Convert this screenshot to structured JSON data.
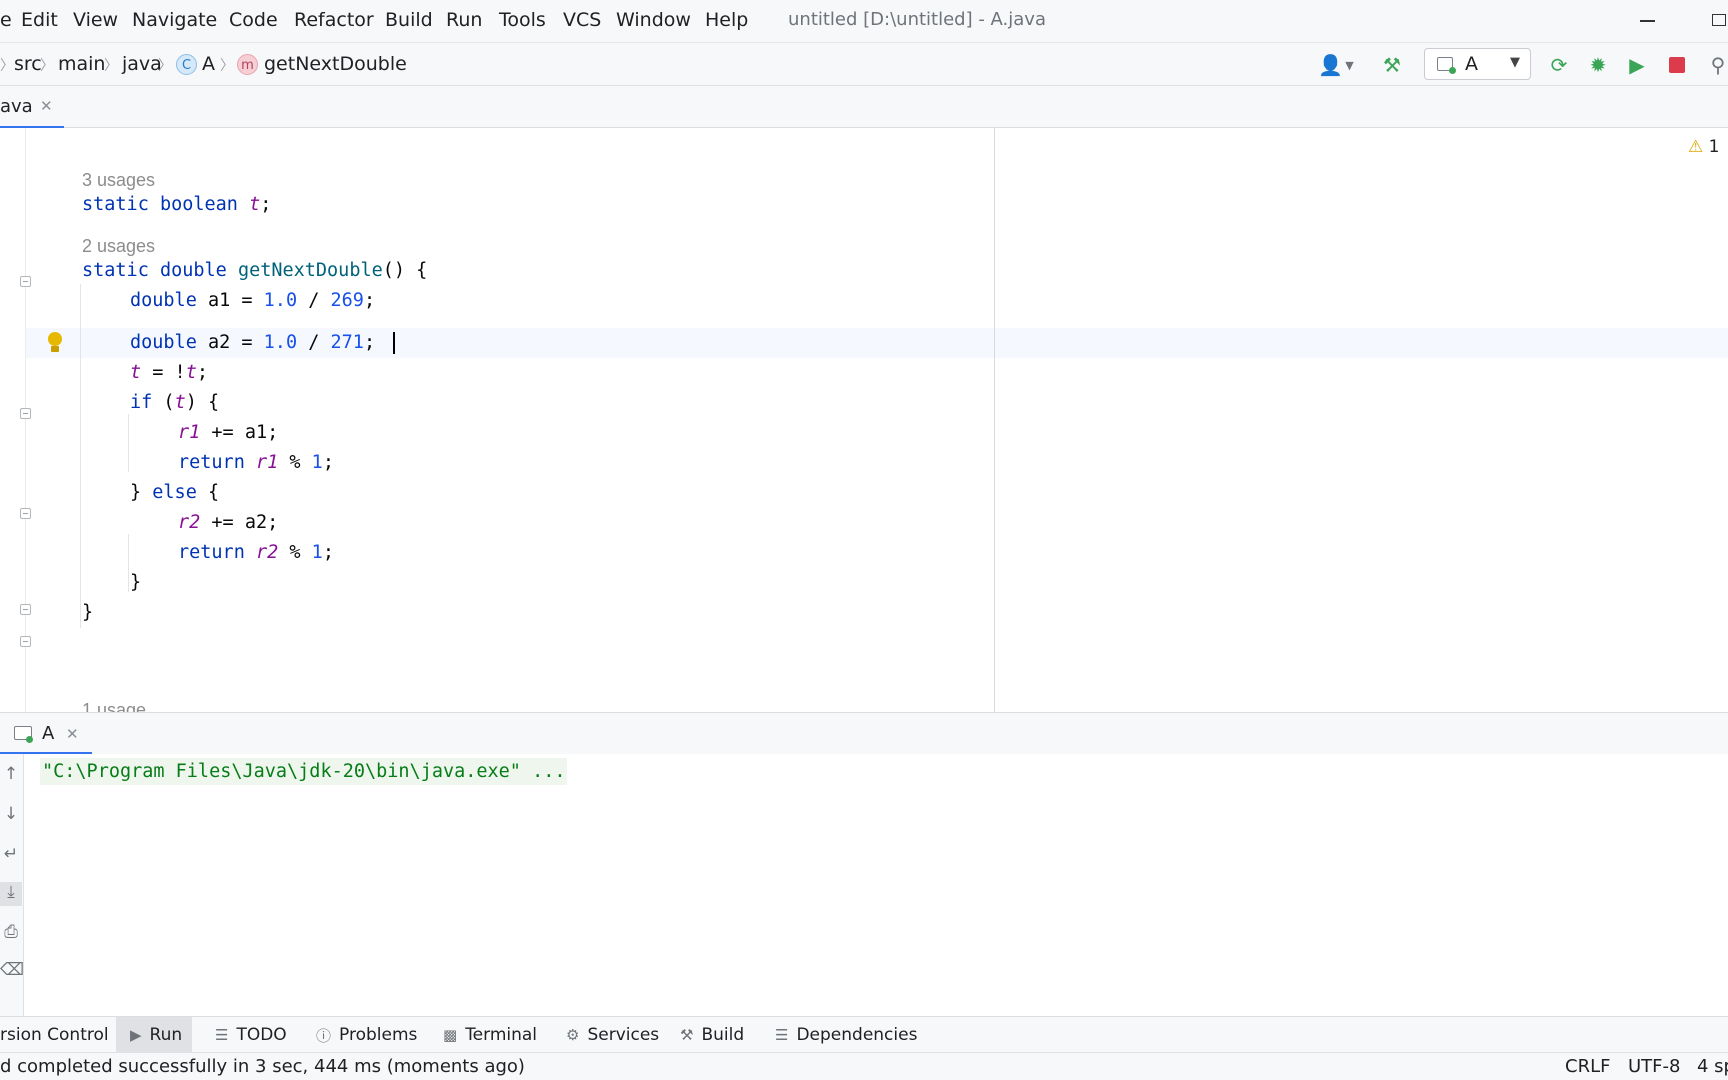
{
  "window": {
    "title": "untitled [D:\\untitled] - A.java"
  },
  "menu": {
    "file_fragment": "e",
    "items": [
      {
        "label_rest": "dit",
        "mnemonic": "E"
      },
      {
        "label_rest": "iew",
        "mnemonic": "V"
      },
      {
        "label_rest": "avigate",
        "mnemonic": "N"
      },
      {
        "label_rest": "ode",
        "mnemonic": "C"
      },
      {
        "label_rest": "efactor",
        "mnemonic": "R"
      },
      {
        "label_rest": "uild",
        "mnemonic": "B"
      },
      {
        "label_rest": "un",
        "mnemonic": "R",
        "tail": "u",
        "lead": ""
      },
      {
        "label_rest": "ools",
        "mnemonic": "T"
      },
      {
        "label_rest": "",
        "mnemonic": "VCS"
      },
      {
        "label_rest": "indow",
        "mnemonic": "W"
      },
      {
        "label_rest": "elp",
        "mnemonic": "H"
      }
    ],
    "labels": [
      "Edit",
      "View",
      "Navigate",
      "Code",
      "Refactor",
      "Build",
      "Run",
      "Tools",
      "VCS",
      "Window",
      "Help"
    ]
  },
  "breadcrumb": {
    "items": [
      "src",
      "main",
      "java",
      "A",
      "getNextDouble"
    ],
    "class_badge": "C",
    "method_badge": "m"
  },
  "toolbar": {
    "run_config": "A",
    "icons": [
      "user-dropdown-icon",
      "hammer-build-icon",
      "rerun-icon",
      "debug-bug-icon",
      "coverage-icon",
      "stop-icon",
      "search-icon"
    ]
  },
  "editor": {
    "tab_label": "ava",
    "warnings_count": "1",
    "usage_hints": [
      "3 usages",
      "2 usages",
      "1 usage"
    ],
    "code": {
      "l1": {
        "kw1": "static",
        "kw2": "boolean",
        "field": "t",
        "tail": ";"
      },
      "l2": {
        "kw1": "static",
        "kw2": "double",
        "method": "getNextDouble",
        "tail": "() {"
      },
      "l3": {
        "kw": "double",
        "var": "a1",
        "op": " = ",
        "n1": "1.0",
        "div": " / ",
        "n2": "269",
        "tail": ";"
      },
      "l4": {
        "kw": "double",
        "var": "a2",
        "op": " = ",
        "n1": "1.0",
        "div": " / ",
        "n2": "271",
        "tail": ";"
      },
      "l5": {
        "field1": "t",
        "op": " = !",
        "field2": "t",
        "tail": ";"
      },
      "l6": {
        "kw": "if",
        "open": " (",
        "field": "t",
        "tail": ") {"
      },
      "l7": {
        "field": "r1",
        "tail": " += a1;"
      },
      "l8": {
        "kw": "return",
        "field": "r1",
        "op": " % ",
        "num": "1",
        "tail": ";"
      },
      "l9": {
        "lead": "} ",
        "kw": "else",
        "tail": " {"
      },
      "l10": {
        "field": "r2",
        "tail": " += a2;"
      },
      "l11": {
        "kw": "return",
        "field": "r2",
        "op": " % ",
        "num": "1",
        "tail": ";"
      },
      "l12": {
        "text": "}"
      },
      "l13": {
        "text": "}"
      }
    }
  },
  "run_panel": {
    "tab_label": "A",
    "console_line": "\"C:\\Program Files\\Java\\jdk-20\\bin\\java.exe\" ..."
  },
  "tool_windows": {
    "version_control": "rsion Control",
    "run": "Run",
    "todo": "TODO",
    "problems": "Problems",
    "terminal": "Terminal",
    "services": "Services",
    "build": "Build",
    "dependencies": "Dependencies"
  },
  "status": {
    "message": "d completed successfully in 3 sec, 444 ms (moments ago)",
    "line_separator": "CRLF",
    "encoding": "UTF-8",
    "indent": "4 sp"
  },
  "colors": {
    "keyword": "#0033b3",
    "number": "#1750eb",
    "field": "#871094",
    "method": "#00627a",
    "console_text": "#067d17",
    "accent": "#3574f0"
  }
}
